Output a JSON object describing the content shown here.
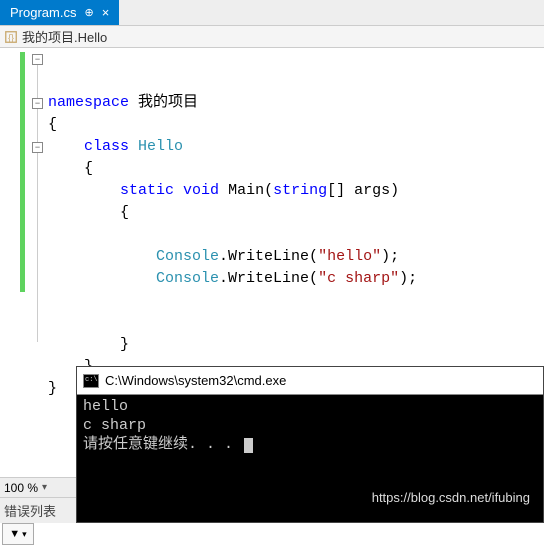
{
  "tab": {
    "filename": "Program.cs",
    "pinned": true
  },
  "breadcrumb": {
    "text": "我的项目.Hello"
  },
  "code": {
    "namespace_kw": "namespace",
    "namespace_name": "我的项目",
    "class_kw": "class",
    "class_name": "Hello",
    "static_kw": "static",
    "void_kw": "void",
    "main_name": "Main",
    "string_kw": "string",
    "args": "[] args)",
    "console": "Console",
    "writeline": ".WriteLine(",
    "str1": "\"hello\"",
    "str2": "\"c sharp\"",
    "end": ");",
    "brace_open": "{",
    "brace_close": "}"
  },
  "cmd": {
    "title": "C:\\Windows\\system32\\cmd.exe",
    "line1": "hello",
    "line2": "c sharp",
    "line3": "请按任意键继续. . . "
  },
  "zoom": {
    "value": "100 %"
  },
  "errlist": {
    "label": "错误列表"
  },
  "watermark": "https://blog.csdn.net/ifubing"
}
